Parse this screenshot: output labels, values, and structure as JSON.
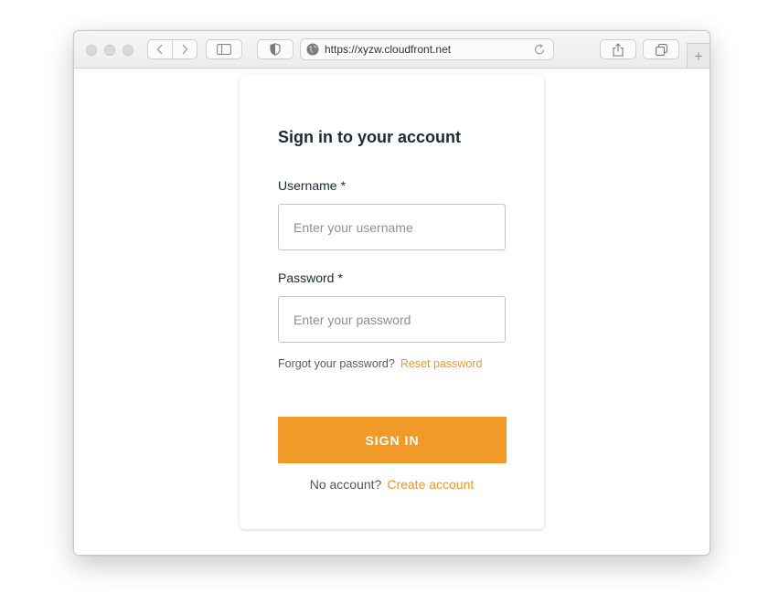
{
  "browser": {
    "url": "https://xyzw.cloudfront.net",
    "new_tab_symbol": "+"
  },
  "signin_form": {
    "title": "Sign in to your account",
    "username": {
      "label": "Username",
      "required_mark": "*",
      "placeholder": "Enter your username",
      "value": ""
    },
    "password": {
      "label": "Password",
      "required_mark": "*",
      "placeholder": "Enter your password",
      "value": ""
    },
    "forgot_text": "Forgot your password?",
    "reset_link": "Reset password",
    "submit_label": "SIGN IN",
    "no_account_text": "No account?",
    "create_account_link": "Create account"
  },
  "colors": {
    "accent": "#f19a27",
    "title_text": "#1c2a38"
  }
}
